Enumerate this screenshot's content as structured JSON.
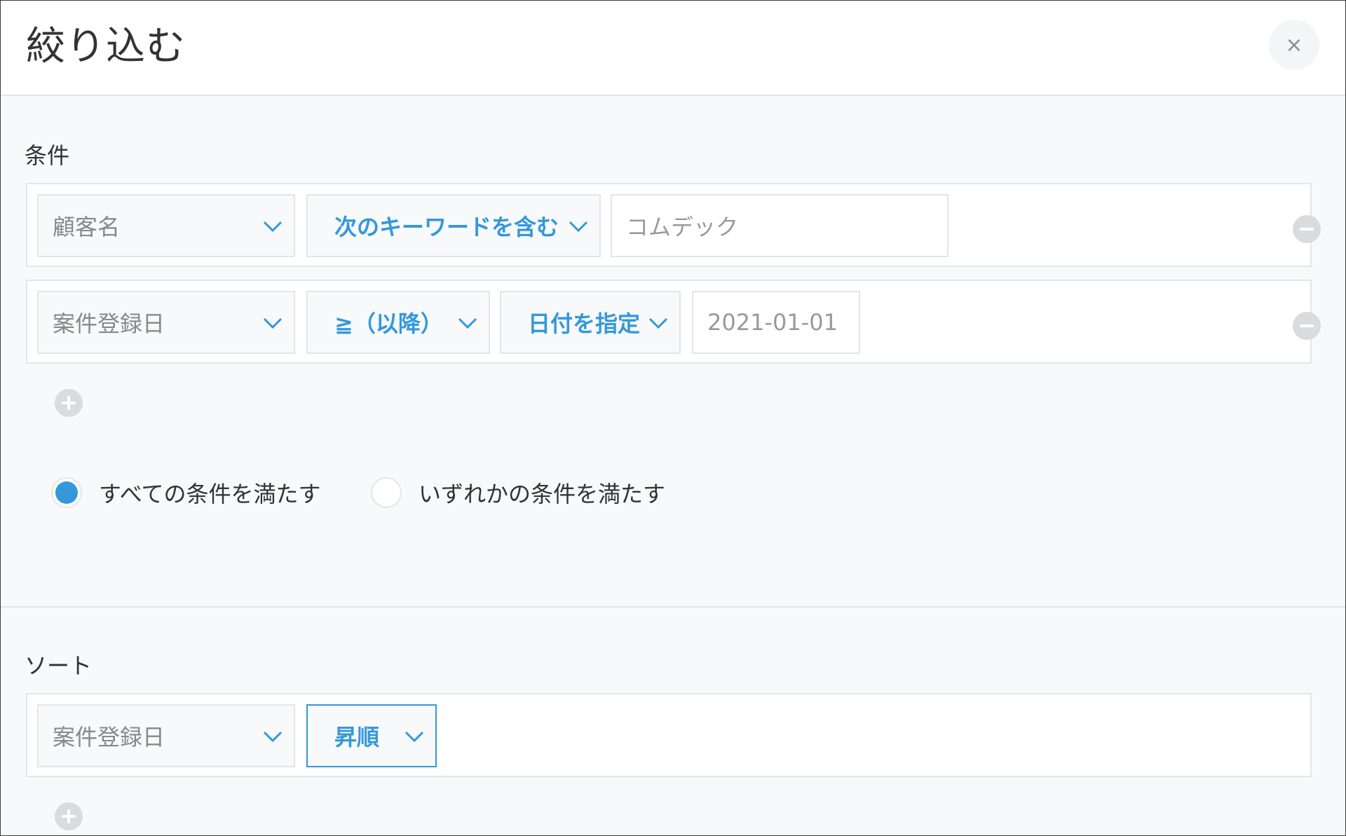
{
  "dialog": {
    "title": "絞り込む",
    "close_label": "×"
  },
  "conditions": {
    "label": "条件",
    "rows": [
      {
        "field": "顧客名",
        "operator": "次のキーワードを含む",
        "value": "コムデック"
      },
      {
        "field": "案件登録日",
        "operator": "≧（以降）",
        "date_mode": "日付を指定",
        "value": "2021-01-01"
      }
    ],
    "match_options": [
      {
        "label": "すべての条件を満たす",
        "selected": true
      },
      {
        "label": "いずれかの条件を満たす",
        "selected": false
      }
    ]
  },
  "sort": {
    "label": "ソート",
    "rows": [
      {
        "field": "案件登録日",
        "order": "昇順"
      }
    ]
  },
  "colors": {
    "accent": "#3498db",
    "border": "#e3e6e8",
    "panel_bg": "#f7f9fa"
  }
}
